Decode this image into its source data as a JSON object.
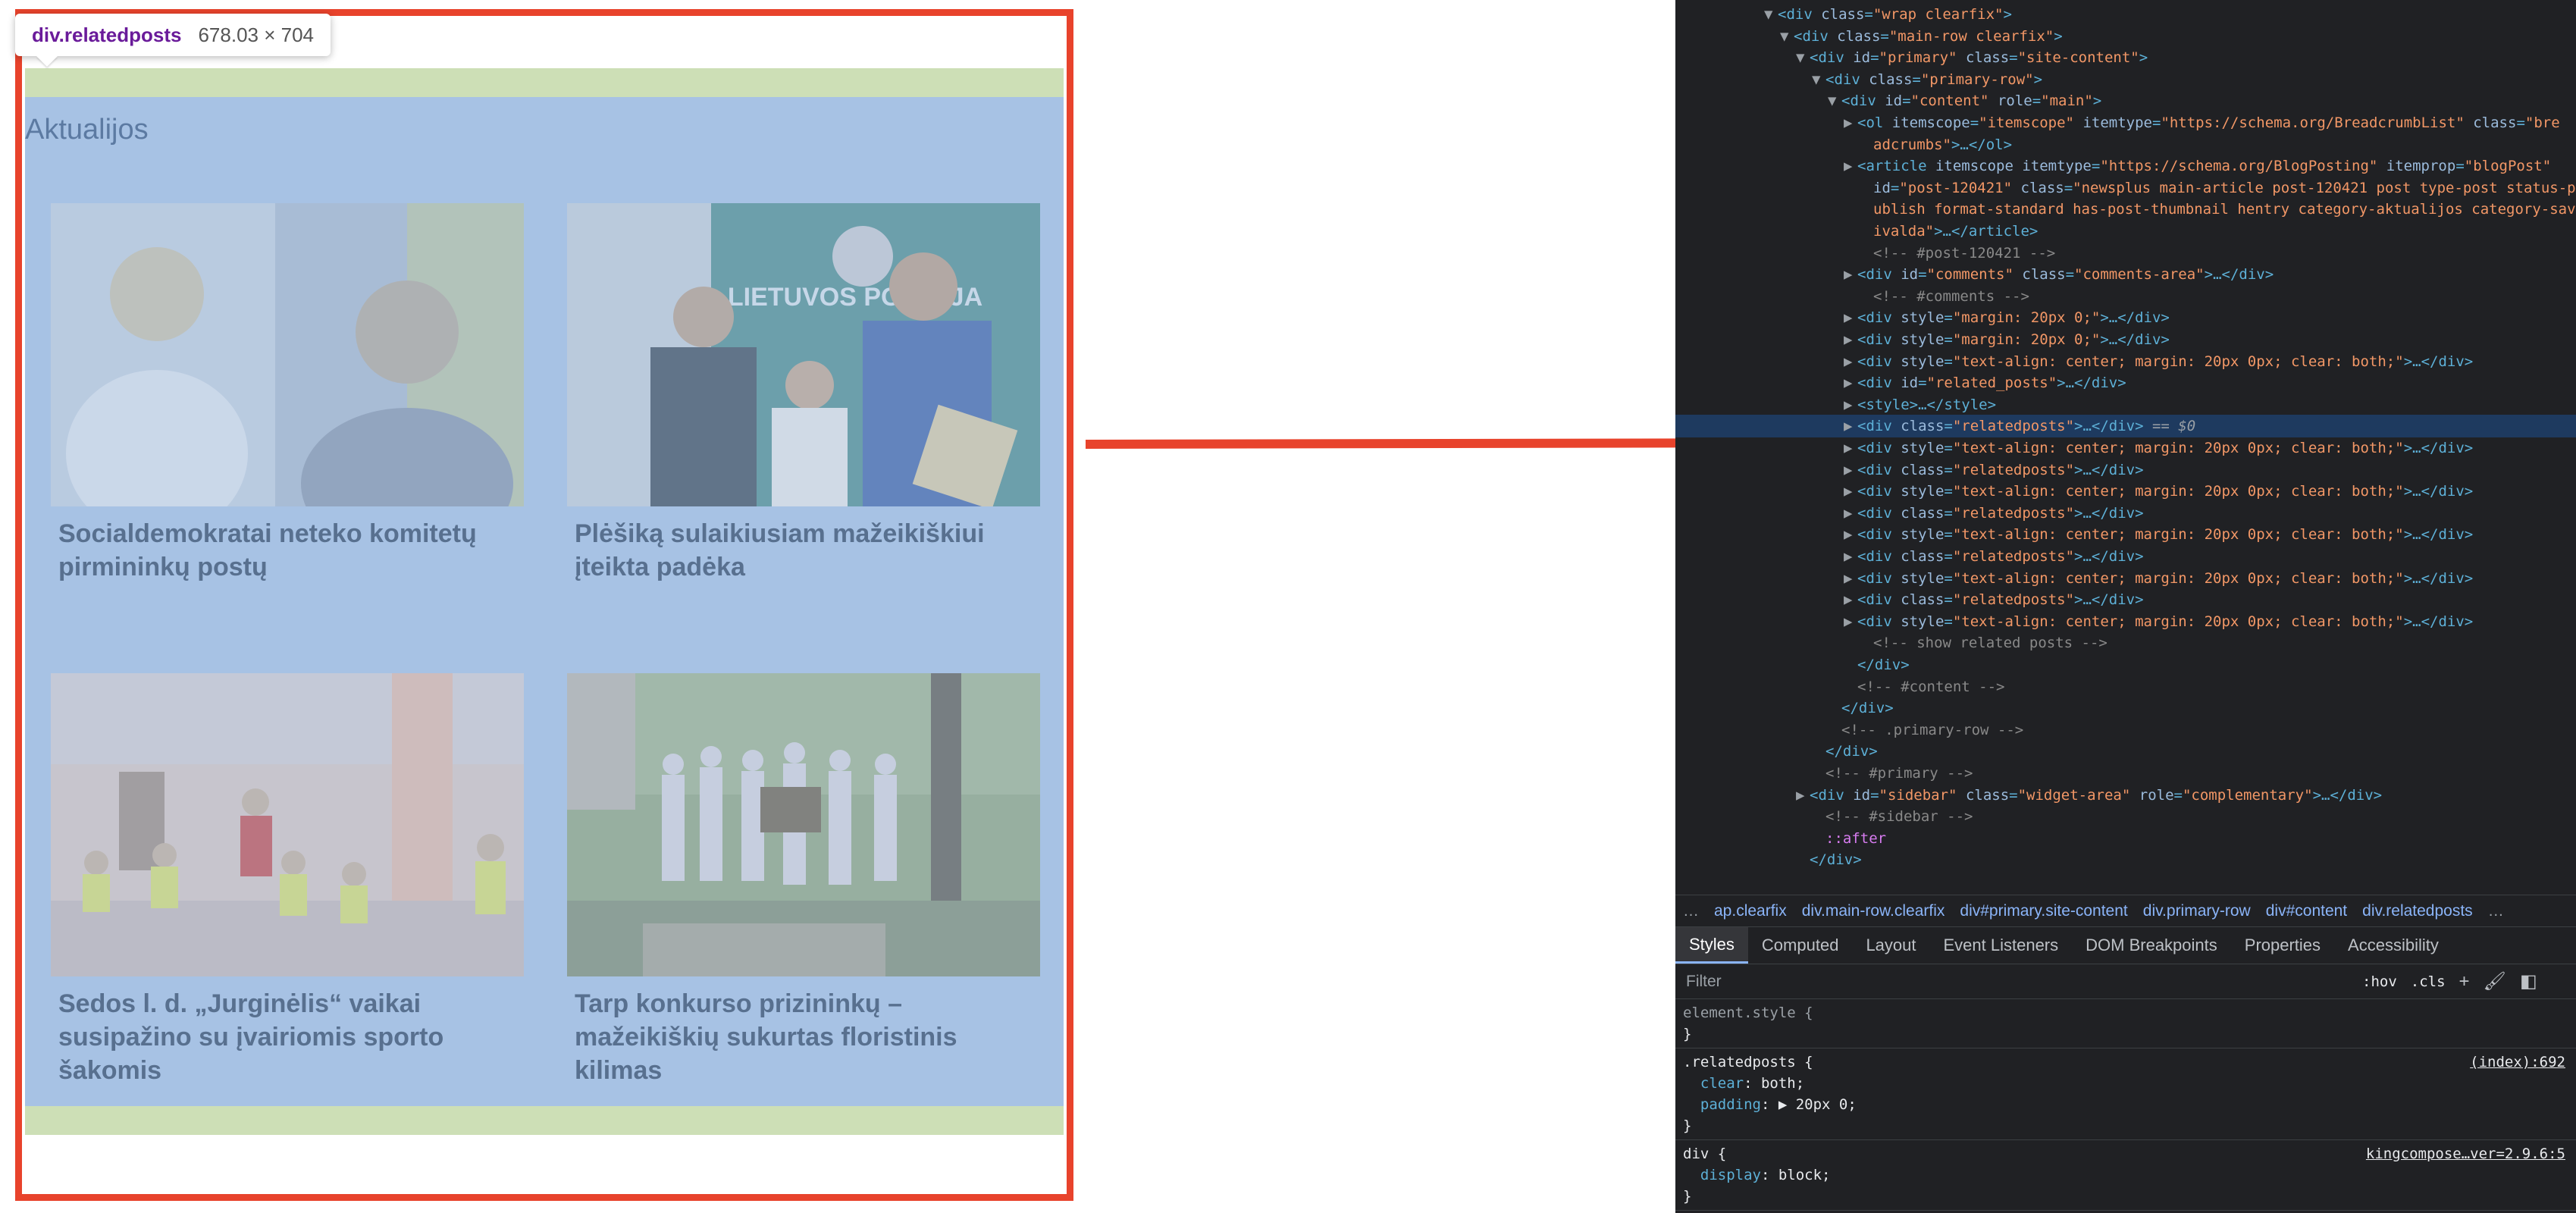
{
  "tooltip": {
    "selector": "div.relatedposts",
    "size": "678.03 × 704"
  },
  "section_title": "Aktualijos",
  "posts": [
    {
      "title": "Socialdemokratai neteko komitetų pirmininkų postų",
      "image": "two-portraits-photo"
    },
    {
      "title": "Plėšiką sulaikiusiam mažeikiškiui įteikta padėka",
      "image": "police-award-photo",
      "image_text": "LIETUVOS POLICIJA"
    },
    {
      "title": "Sedos l. d. „Jurginėlis“ vaikai susipažino su įvairiomis sporto šakomis",
      "image": "kids-sports-photo"
    },
    {
      "title": "Tarp konkurso prizininkų – mažeikiškių sukurtas floristinis kilimas",
      "image": "group-outdoor-photo"
    }
  ],
  "colors": {
    "highlight": "#e8432c",
    "content_overlay": "#a7c2e4",
    "margin_overlay": "#cddfb6",
    "devtools_bg": "#202124"
  },
  "dom": [
    {
      "indent": 5,
      "tri": "▼",
      "parts": [
        [
          "tag",
          "<div "
        ],
        [
          "attr",
          "class"
        ],
        [
          "tag",
          "="
        ],
        [
          "val",
          "\"wrap clearfix\""
        ],
        [
          "tag",
          ">"
        ]
      ]
    },
    {
      "indent": 6,
      "tri": "▼",
      "parts": [
        [
          "tag",
          "<div "
        ],
        [
          "attr",
          "class"
        ],
        [
          "tag",
          "="
        ],
        [
          "val",
          "\"main-row clearfix\""
        ],
        [
          "tag",
          ">"
        ]
      ]
    },
    {
      "indent": 7,
      "tri": "▼",
      "parts": [
        [
          "tag",
          "<div "
        ],
        [
          "attr",
          "id"
        ],
        [
          "tag",
          "="
        ],
        [
          "val",
          "\"primary\""
        ],
        [
          "attr",
          " class"
        ],
        [
          "tag",
          "="
        ],
        [
          "val",
          "\"site-content\""
        ],
        [
          "tag",
          ">"
        ]
      ]
    },
    {
      "indent": 8,
      "tri": "▼",
      "parts": [
        [
          "tag",
          "<div "
        ],
        [
          "attr",
          "class"
        ],
        [
          "tag",
          "="
        ],
        [
          "val",
          "\"primary-row\""
        ],
        [
          "tag",
          ">"
        ]
      ]
    },
    {
      "indent": 9,
      "tri": "▼",
      "parts": [
        [
          "tag",
          "<div "
        ],
        [
          "attr",
          "id"
        ],
        [
          "tag",
          "="
        ],
        [
          "val",
          "\"content\""
        ],
        [
          "attr",
          " role"
        ],
        [
          "tag",
          "="
        ],
        [
          "val",
          "\"main\""
        ],
        [
          "tag",
          ">"
        ]
      ]
    },
    {
      "indent": 10,
      "tri": "▶",
      "parts": [
        [
          "tag",
          "<ol "
        ],
        [
          "attr",
          "itemscope"
        ],
        [
          "tag",
          "="
        ],
        [
          "val",
          "\"itemscope\""
        ],
        [
          "attr",
          " itemtype"
        ],
        [
          "tag",
          "="
        ],
        [
          "val",
          "\"https://schema.org/BreadcrumbList\""
        ],
        [
          "attr",
          " class"
        ],
        [
          "tag",
          "="
        ],
        [
          "val",
          "\"bre"
        ]
      ]
    },
    {
      "indent": 11,
      "tri": "",
      "parts": [
        [
          "val",
          "adcrumbs\""
        ],
        [
          "tag",
          ">…</ol>"
        ]
      ]
    },
    {
      "indent": 10,
      "tri": "▶",
      "parts": [
        [
          "tag",
          "<article "
        ],
        [
          "attr",
          "itemscope"
        ],
        [
          "attr",
          " itemtype"
        ],
        [
          "tag",
          "="
        ],
        [
          "val",
          "\"https://schema.org/BlogPosting\""
        ],
        [
          "attr",
          " itemprop"
        ],
        [
          "tag",
          "="
        ],
        [
          "val",
          "\"blogPost\""
        ]
      ]
    },
    {
      "indent": 11,
      "tri": "",
      "parts": [
        [
          "attr",
          "id"
        ],
        [
          "tag",
          "="
        ],
        [
          "val",
          "\"post-120421\""
        ],
        [
          "attr",
          " class"
        ],
        [
          "tag",
          "="
        ],
        [
          "val",
          "\"newsplus main-article post-120421 post type-post status-p"
        ]
      ]
    },
    {
      "indent": 11,
      "tri": "",
      "parts": [
        [
          "val",
          "ublish format-standard has-post-thumbnail hentry category-aktualijos category-sav"
        ]
      ]
    },
    {
      "indent": 11,
      "tri": "",
      "parts": [
        [
          "val",
          "ivalda\""
        ],
        [
          "tag",
          ">…</article>"
        ]
      ]
    },
    {
      "indent": 11,
      "tri": "",
      "parts": [
        [
          "cmt",
          "<!-- #post-120421 -->"
        ]
      ]
    },
    {
      "indent": 10,
      "tri": "▶",
      "parts": [
        [
          "tag",
          "<div "
        ],
        [
          "attr",
          "id"
        ],
        [
          "tag",
          "="
        ],
        [
          "val",
          "\"comments\""
        ],
        [
          "attr",
          " class"
        ],
        [
          "tag",
          "="
        ],
        [
          "val",
          "\"comments-area\""
        ],
        [
          "tag",
          ">…</div>"
        ]
      ]
    },
    {
      "indent": 11,
      "tri": "",
      "parts": [
        [
          "cmt",
          "<!-- #comments -->"
        ]
      ]
    },
    {
      "indent": 10,
      "tri": "▶",
      "parts": [
        [
          "tag",
          "<div "
        ],
        [
          "attr",
          "style"
        ],
        [
          "tag",
          "="
        ],
        [
          "val",
          "\"margin: 20px 0;\""
        ],
        [
          "tag",
          ">…</div>"
        ]
      ]
    },
    {
      "indent": 10,
      "tri": "▶",
      "parts": [
        [
          "tag",
          "<div "
        ],
        [
          "attr",
          "style"
        ],
        [
          "tag",
          "="
        ],
        [
          "val",
          "\"margin: 20px 0;\""
        ],
        [
          "tag",
          ">…</div>"
        ]
      ]
    },
    {
      "indent": 10,
      "tri": "▶",
      "parts": [
        [
          "tag",
          "<div "
        ],
        [
          "attr",
          "style"
        ],
        [
          "tag",
          "="
        ],
        [
          "val",
          "\"text-align: center; margin: 20px 0px; clear: both;\""
        ],
        [
          "tag",
          ">…</div>"
        ]
      ]
    },
    {
      "indent": 10,
      "tri": "▶",
      "parts": [
        [
          "tag",
          "<div "
        ],
        [
          "attr",
          "id"
        ],
        [
          "tag",
          "="
        ],
        [
          "val",
          "\"related_posts\""
        ],
        [
          "tag",
          ">…</div>"
        ]
      ]
    },
    {
      "indent": 10,
      "tri": "▶",
      "parts": [
        [
          "tag",
          "<style>…</style>"
        ]
      ]
    },
    {
      "indent": 10,
      "tri": "▶",
      "selected": true,
      "parts": [
        [
          "tag",
          "<div "
        ],
        [
          "attr",
          "class"
        ],
        [
          "tag",
          "="
        ],
        [
          "val",
          "\"relatedposts\""
        ],
        [
          "tag",
          ">…</div>"
        ],
        [
          "eq",
          " == $0"
        ]
      ]
    },
    {
      "indent": 10,
      "tri": "▶",
      "parts": [
        [
          "tag",
          "<div "
        ],
        [
          "attr",
          "style"
        ],
        [
          "tag",
          "="
        ],
        [
          "val",
          "\"text-align: center; margin: 20px 0px; clear: both;\""
        ],
        [
          "tag",
          ">…</div>"
        ]
      ]
    },
    {
      "indent": 10,
      "tri": "▶",
      "parts": [
        [
          "tag",
          "<div "
        ],
        [
          "attr",
          "class"
        ],
        [
          "tag",
          "="
        ],
        [
          "val",
          "\"relatedposts\""
        ],
        [
          "tag",
          ">…</div>"
        ]
      ]
    },
    {
      "indent": 10,
      "tri": "▶",
      "parts": [
        [
          "tag",
          "<div "
        ],
        [
          "attr",
          "style"
        ],
        [
          "tag",
          "="
        ],
        [
          "val",
          "\"text-align: center; margin: 20px 0px; clear: both;\""
        ],
        [
          "tag",
          ">…</div>"
        ]
      ]
    },
    {
      "indent": 10,
      "tri": "▶",
      "parts": [
        [
          "tag",
          "<div "
        ],
        [
          "attr",
          "class"
        ],
        [
          "tag",
          "="
        ],
        [
          "val",
          "\"relatedposts\""
        ],
        [
          "tag",
          ">…</div>"
        ]
      ]
    },
    {
      "indent": 10,
      "tri": "▶",
      "parts": [
        [
          "tag",
          "<div "
        ],
        [
          "attr",
          "style"
        ],
        [
          "tag",
          "="
        ],
        [
          "val",
          "\"text-align: center; margin: 20px 0px; clear: both;\""
        ],
        [
          "tag",
          ">…</div>"
        ]
      ]
    },
    {
      "indent": 10,
      "tri": "▶",
      "parts": [
        [
          "tag",
          "<div "
        ],
        [
          "attr",
          "class"
        ],
        [
          "tag",
          "="
        ],
        [
          "val",
          "\"relatedposts\""
        ],
        [
          "tag",
          ">…</div>"
        ]
      ]
    },
    {
      "indent": 10,
      "tri": "▶",
      "parts": [
        [
          "tag",
          "<div "
        ],
        [
          "attr",
          "style"
        ],
        [
          "tag",
          "="
        ],
        [
          "val",
          "\"text-align: center; margin: 20px 0px; clear: both;\""
        ],
        [
          "tag",
          ">…</div>"
        ]
      ]
    },
    {
      "indent": 10,
      "tri": "▶",
      "parts": [
        [
          "tag",
          "<div "
        ],
        [
          "attr",
          "class"
        ],
        [
          "tag",
          "="
        ],
        [
          "val",
          "\"relatedposts\""
        ],
        [
          "tag",
          ">…</div>"
        ]
      ]
    },
    {
      "indent": 10,
      "tri": "▶",
      "parts": [
        [
          "tag",
          "<div "
        ],
        [
          "attr",
          "style"
        ],
        [
          "tag",
          "="
        ],
        [
          "val",
          "\"text-align: center; margin: 20px 0px; clear: both;\""
        ],
        [
          "tag",
          ">…</div>"
        ]
      ]
    },
    {
      "indent": 11,
      "tri": "",
      "parts": [
        [
          "cmt",
          "<!-- show related posts -->"
        ]
      ]
    },
    {
      "indent": 10,
      "tri": "",
      "parts": [
        [
          "tag",
          "</div>"
        ]
      ]
    },
    {
      "indent": 10,
      "tri": "",
      "parts": [
        [
          "cmt",
          "<!-- #content -->"
        ]
      ]
    },
    {
      "indent": 9,
      "tri": "",
      "parts": [
        [
          "tag",
          "</div>"
        ]
      ]
    },
    {
      "indent": 9,
      "tri": "",
      "parts": [
        [
          "cmt",
          "<!-- .primary-row -->"
        ]
      ]
    },
    {
      "indent": 8,
      "tri": "",
      "parts": [
        [
          "tag",
          "</div>"
        ]
      ]
    },
    {
      "indent": 8,
      "tri": "",
      "parts": [
        [
          "cmt",
          "<!-- #primary -->"
        ]
      ]
    },
    {
      "indent": 7,
      "tri": "▶",
      "parts": [
        [
          "tag",
          "<div "
        ],
        [
          "attr",
          "id"
        ],
        [
          "tag",
          "="
        ],
        [
          "val",
          "\"sidebar\""
        ],
        [
          "attr",
          " class"
        ],
        [
          "tag",
          "="
        ],
        [
          "val",
          "\"widget-area\""
        ],
        [
          "attr",
          " role"
        ],
        [
          "tag",
          "="
        ],
        [
          "val",
          "\"complementary\""
        ],
        [
          "tag",
          ">…</div>"
        ]
      ]
    },
    {
      "indent": 8,
      "tri": "",
      "parts": [
        [
          "cmt",
          "<!-- #sidebar -->"
        ]
      ]
    },
    {
      "indent": 8,
      "tri": "",
      "parts": [
        [
          "pseudo",
          "::after"
        ]
      ]
    },
    {
      "indent": 7,
      "tri": "",
      "parts": [
        [
          "tag",
          "</div>"
        ]
      ]
    }
  ],
  "breadcrumbs": {
    "more_left": "…",
    "items": [
      "ap.clearfix",
      "div.main-row.clearfix",
      "div#primary.site-content",
      "div.primary-row",
      "div#content",
      "div.relatedposts"
    ],
    "more_right": "…"
  },
  "tabs": [
    "Styles",
    "Computed",
    "Layout",
    "Event Listeners",
    "DOM Breakpoints",
    "Properties",
    "Accessibility"
  ],
  "active_tab": "Styles",
  "filter": {
    "placeholder": "Filter",
    "hov": ":hov",
    "cls": ".cls",
    "plus": "+"
  },
  "styles": [
    {
      "lines": [
        {
          "text": "element.style {",
          "kind": "dim"
        },
        {
          "text": "}",
          "kind": "plain"
        }
      ]
    },
    {
      "source": "(index):692",
      "lines": [
        {
          "text": ".relatedposts {",
          "kind": "plain"
        },
        {
          "prop": "clear",
          "value": "both;"
        },
        {
          "prop": "padding",
          "value": "▶ 20px 0;"
        },
        {
          "text": "}",
          "kind": "plain"
        }
      ]
    },
    {
      "source": "kingcompose…ver=2.9.6:5",
      "lines": [
        {
          "text": "div {",
          "kind": "plain"
        },
        {
          "prop": "display",
          "value": "block;"
        },
        {
          "text": "}",
          "kind": "plain"
        }
      ]
    }
  ]
}
